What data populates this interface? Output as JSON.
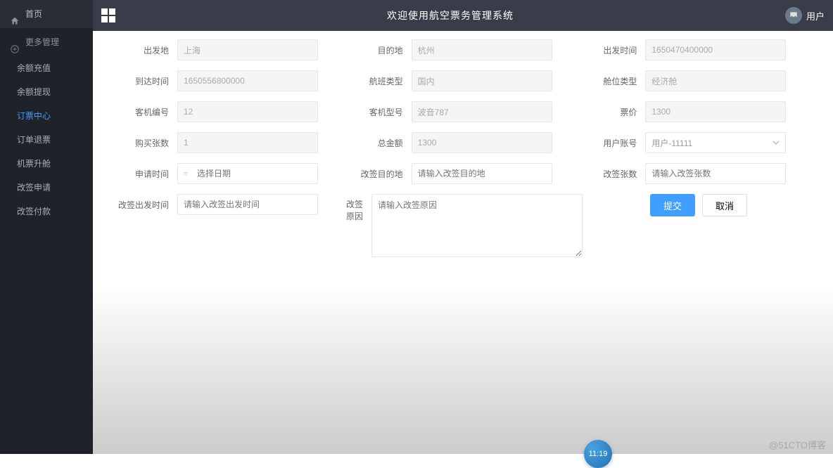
{
  "sidebar": {
    "home": "首页",
    "more": "更多管理",
    "items": [
      "余额充值",
      "余额提现",
      "订票中心",
      "订单退票",
      "机票升舱",
      "改签申请",
      "改签付款"
    ],
    "active_index": 2
  },
  "topbar": {
    "title": "欢迎使用航空票务管理系统",
    "user_label": "用户"
  },
  "form": {
    "departure": {
      "label": "出发地",
      "value": "上海"
    },
    "destination": {
      "label": "目的地",
      "value": "杭州"
    },
    "depart_time": {
      "label": "出发时间",
      "value": "1650470400000"
    },
    "arrive_time": {
      "label": "到达时间",
      "value": "1650556800000"
    },
    "flight_type": {
      "label": "航班类型",
      "value": "国内"
    },
    "seat_class": {
      "label": "舱位类型",
      "value": "经济舱"
    },
    "plane_no": {
      "label": "客机编号",
      "value": "12"
    },
    "plane_model": {
      "label": "客机型号",
      "value": "波音787"
    },
    "price": {
      "label": "票价",
      "value": "1300"
    },
    "buy_count": {
      "label": "购买张数",
      "value": "1"
    },
    "total": {
      "label": "总金额",
      "value": "1300"
    },
    "user_account": {
      "label": "用户账号",
      "value": "用户-11111"
    },
    "apply_time": {
      "label": "申请时间",
      "placeholder": "选择日期"
    },
    "change_dest": {
      "label": "改签目的地",
      "placeholder": "请输入改签目的地"
    },
    "change_count": {
      "label": "改签张数",
      "placeholder": "请输入改签张数"
    },
    "change_depart_time": {
      "label": "改签出发时间",
      "placeholder": "请输入改签出发时间"
    },
    "change_reason": {
      "label": "改签原因",
      "placeholder": "请输入改签原因"
    }
  },
  "buttons": {
    "submit": "提交",
    "cancel": "取消"
  },
  "footer": {
    "watermark": "@51CTO博客",
    "timestamp_badge": "11:19"
  }
}
